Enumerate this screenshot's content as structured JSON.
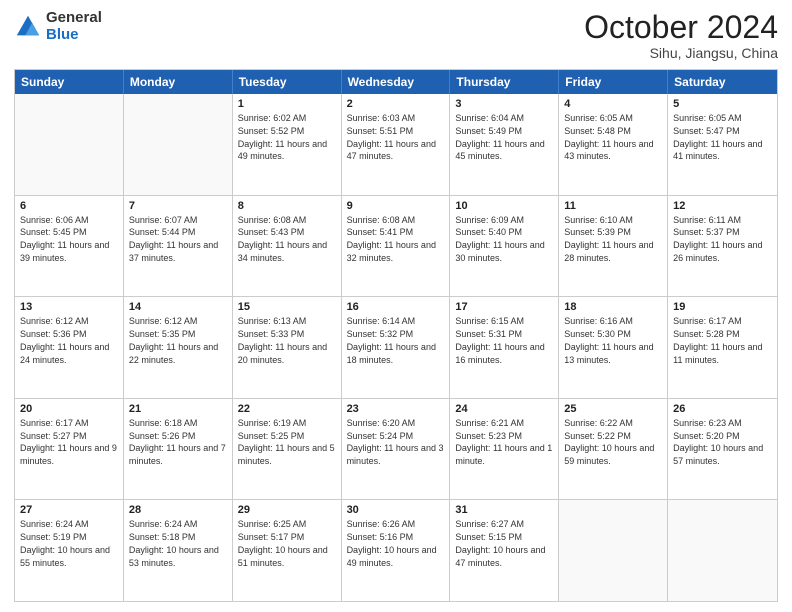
{
  "header": {
    "logo_general": "General",
    "logo_blue": "Blue",
    "month_title": "October 2024",
    "subtitle": "Sihu, Jiangsu, China"
  },
  "weekdays": [
    "Sunday",
    "Monday",
    "Tuesday",
    "Wednesday",
    "Thursday",
    "Friday",
    "Saturday"
  ],
  "weeks": [
    [
      {
        "day": "",
        "info": ""
      },
      {
        "day": "",
        "info": ""
      },
      {
        "day": "1",
        "info": "Sunrise: 6:02 AM\nSunset: 5:52 PM\nDaylight: 11 hours and 49 minutes."
      },
      {
        "day": "2",
        "info": "Sunrise: 6:03 AM\nSunset: 5:51 PM\nDaylight: 11 hours and 47 minutes."
      },
      {
        "day": "3",
        "info": "Sunrise: 6:04 AM\nSunset: 5:49 PM\nDaylight: 11 hours and 45 minutes."
      },
      {
        "day": "4",
        "info": "Sunrise: 6:05 AM\nSunset: 5:48 PM\nDaylight: 11 hours and 43 minutes."
      },
      {
        "day": "5",
        "info": "Sunrise: 6:05 AM\nSunset: 5:47 PM\nDaylight: 11 hours and 41 minutes."
      }
    ],
    [
      {
        "day": "6",
        "info": "Sunrise: 6:06 AM\nSunset: 5:45 PM\nDaylight: 11 hours and 39 minutes."
      },
      {
        "day": "7",
        "info": "Sunrise: 6:07 AM\nSunset: 5:44 PM\nDaylight: 11 hours and 37 minutes."
      },
      {
        "day": "8",
        "info": "Sunrise: 6:08 AM\nSunset: 5:43 PM\nDaylight: 11 hours and 34 minutes."
      },
      {
        "day": "9",
        "info": "Sunrise: 6:08 AM\nSunset: 5:41 PM\nDaylight: 11 hours and 32 minutes."
      },
      {
        "day": "10",
        "info": "Sunrise: 6:09 AM\nSunset: 5:40 PM\nDaylight: 11 hours and 30 minutes."
      },
      {
        "day": "11",
        "info": "Sunrise: 6:10 AM\nSunset: 5:39 PM\nDaylight: 11 hours and 28 minutes."
      },
      {
        "day": "12",
        "info": "Sunrise: 6:11 AM\nSunset: 5:37 PM\nDaylight: 11 hours and 26 minutes."
      }
    ],
    [
      {
        "day": "13",
        "info": "Sunrise: 6:12 AM\nSunset: 5:36 PM\nDaylight: 11 hours and 24 minutes."
      },
      {
        "day": "14",
        "info": "Sunrise: 6:12 AM\nSunset: 5:35 PM\nDaylight: 11 hours and 22 minutes."
      },
      {
        "day": "15",
        "info": "Sunrise: 6:13 AM\nSunset: 5:33 PM\nDaylight: 11 hours and 20 minutes."
      },
      {
        "day": "16",
        "info": "Sunrise: 6:14 AM\nSunset: 5:32 PM\nDaylight: 11 hours and 18 minutes."
      },
      {
        "day": "17",
        "info": "Sunrise: 6:15 AM\nSunset: 5:31 PM\nDaylight: 11 hours and 16 minutes."
      },
      {
        "day": "18",
        "info": "Sunrise: 6:16 AM\nSunset: 5:30 PM\nDaylight: 11 hours and 13 minutes."
      },
      {
        "day": "19",
        "info": "Sunrise: 6:17 AM\nSunset: 5:28 PM\nDaylight: 11 hours and 11 minutes."
      }
    ],
    [
      {
        "day": "20",
        "info": "Sunrise: 6:17 AM\nSunset: 5:27 PM\nDaylight: 11 hours and 9 minutes."
      },
      {
        "day": "21",
        "info": "Sunrise: 6:18 AM\nSunset: 5:26 PM\nDaylight: 11 hours and 7 minutes."
      },
      {
        "day": "22",
        "info": "Sunrise: 6:19 AM\nSunset: 5:25 PM\nDaylight: 11 hours and 5 minutes."
      },
      {
        "day": "23",
        "info": "Sunrise: 6:20 AM\nSunset: 5:24 PM\nDaylight: 11 hours and 3 minutes."
      },
      {
        "day": "24",
        "info": "Sunrise: 6:21 AM\nSunset: 5:23 PM\nDaylight: 11 hours and 1 minute."
      },
      {
        "day": "25",
        "info": "Sunrise: 6:22 AM\nSunset: 5:22 PM\nDaylight: 10 hours and 59 minutes."
      },
      {
        "day": "26",
        "info": "Sunrise: 6:23 AM\nSunset: 5:20 PM\nDaylight: 10 hours and 57 minutes."
      }
    ],
    [
      {
        "day": "27",
        "info": "Sunrise: 6:24 AM\nSunset: 5:19 PM\nDaylight: 10 hours and 55 minutes."
      },
      {
        "day": "28",
        "info": "Sunrise: 6:24 AM\nSunset: 5:18 PM\nDaylight: 10 hours and 53 minutes."
      },
      {
        "day": "29",
        "info": "Sunrise: 6:25 AM\nSunset: 5:17 PM\nDaylight: 10 hours and 51 minutes."
      },
      {
        "day": "30",
        "info": "Sunrise: 6:26 AM\nSunset: 5:16 PM\nDaylight: 10 hours and 49 minutes."
      },
      {
        "day": "31",
        "info": "Sunrise: 6:27 AM\nSunset: 5:15 PM\nDaylight: 10 hours and 47 minutes."
      },
      {
        "day": "",
        "info": ""
      },
      {
        "day": "",
        "info": ""
      }
    ]
  ]
}
